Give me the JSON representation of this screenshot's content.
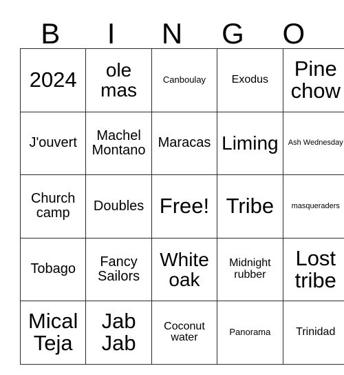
{
  "card": {
    "header_letters": [
      "B",
      "I",
      "N",
      "G",
      "O"
    ],
    "rows": [
      [
        {
          "label": "2024",
          "size": "xl"
        },
        {
          "label": "ole mas",
          "size": "lg"
        },
        {
          "label": "Canboulay",
          "size": "xs"
        },
        {
          "label": "Exodus",
          "size": "sm"
        },
        {
          "label": "Pine chow",
          "size": "xl"
        }
      ],
      [
        {
          "label": "J'ouvert",
          "size": "md"
        },
        {
          "label": "Machel Montano",
          "size": "md"
        },
        {
          "label": "Maracas",
          "size": "md"
        },
        {
          "label": "Liming",
          "size": "lg"
        },
        {
          "label": "Ash Wednesday",
          "size": "xxs"
        }
      ],
      [
        {
          "label": "Church camp",
          "size": "md"
        },
        {
          "label": "Doubles",
          "size": "md"
        },
        {
          "label": "Free!",
          "size": "xl"
        },
        {
          "label": "Tribe",
          "size": "xl"
        },
        {
          "label": "masqueraders",
          "size": "xxs"
        }
      ],
      [
        {
          "label": "Tobago",
          "size": "md"
        },
        {
          "label": "Fancy Sailors",
          "size": "md"
        },
        {
          "label": "White oak",
          "size": "lg"
        },
        {
          "label": "Midnight rubber",
          "size": "sm"
        },
        {
          "label": "Lost tribe",
          "size": "xl"
        }
      ],
      [
        {
          "label": "Mical Teja",
          "size": "xl"
        },
        {
          "label": "Jab Jab",
          "size": "xl"
        },
        {
          "label": "Coconut water",
          "size": "sm"
        },
        {
          "label": "Panorama",
          "size": "xs"
        },
        {
          "label": "Trinidad",
          "size": "sm"
        }
      ]
    ]
  }
}
